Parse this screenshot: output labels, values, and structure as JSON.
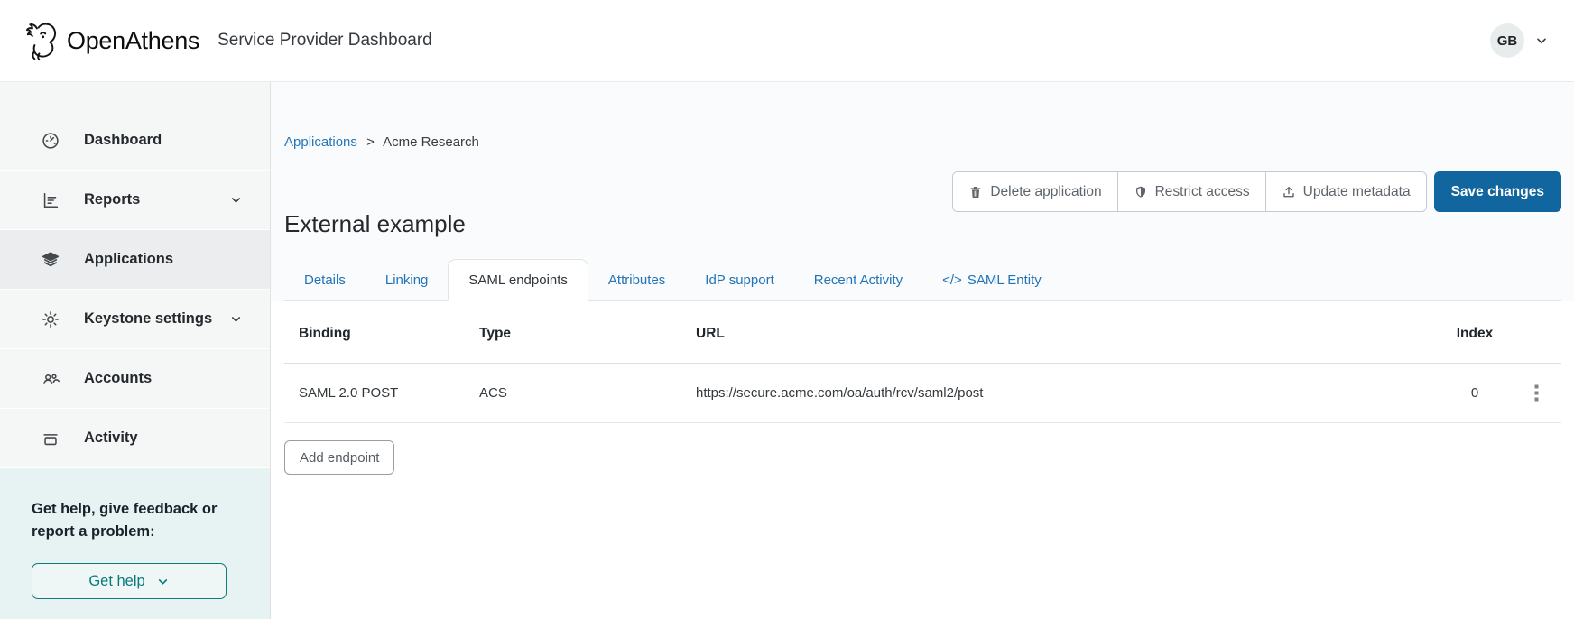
{
  "header": {
    "brand": "OpenAthens",
    "app_title": "Service Provider Dashboard",
    "user_badge": "GB"
  },
  "sidebar": {
    "items": [
      {
        "label": "Dashboard",
        "icon": "gauge-icon",
        "expandable": false,
        "selected": false
      },
      {
        "label": "Reports",
        "icon": "report-icon",
        "expandable": true,
        "selected": false
      },
      {
        "label": "Applications",
        "icon": "layers-icon",
        "expandable": false,
        "selected": true
      },
      {
        "label": "Keystone settings",
        "icon": "gear-icon",
        "expandable": true,
        "selected": false
      },
      {
        "label": "Accounts",
        "icon": "people-icon",
        "expandable": false,
        "selected": false
      },
      {
        "label": "Activity",
        "icon": "archive-icon",
        "expandable": false,
        "selected": false
      }
    ],
    "help": {
      "text": "Get help, give feedback or report a problem:",
      "button_label": "Get help"
    }
  },
  "breadcrumb": {
    "link": "Applications",
    "separator": ">",
    "current": "Acme Research"
  },
  "page": {
    "title": "External example"
  },
  "toolbar": {
    "delete_label": "Delete application",
    "restrict_label": "Restrict access",
    "update_label": "Update metadata",
    "save_label": "Save changes",
    "delete_icon": "trash-icon",
    "restrict_icon": "shield-icon",
    "update_icon": "upload-icon"
  },
  "tabs": {
    "items": [
      {
        "label": "Details",
        "active": false
      },
      {
        "label": "Linking",
        "active": false
      },
      {
        "label": "SAML endpoints",
        "active": true
      },
      {
        "label": "Attributes",
        "active": false
      },
      {
        "label": "IdP support",
        "active": false
      },
      {
        "label": "Recent Activity",
        "active": false
      },
      {
        "prefix": "</>",
        "label": "SAML Entity",
        "active": false
      }
    ]
  },
  "endpoints": {
    "columns": [
      "Binding",
      "Type",
      "URL",
      "Index"
    ],
    "rows": [
      {
        "binding": "SAML 2.0 POST",
        "type": "ACS",
        "url": "https://secure.acme.com/oa/auth/rcv/saml2/post",
        "index": "0"
      }
    ],
    "add_button": "Add endpoint"
  },
  "colors": {
    "primary_button_blue": "#12669f",
    "link_blue": "#2174b8",
    "help_teal": "#0b7a7d",
    "sidebar_bg": "#f5f6f6",
    "help_bg": "#e7f2f2"
  }
}
